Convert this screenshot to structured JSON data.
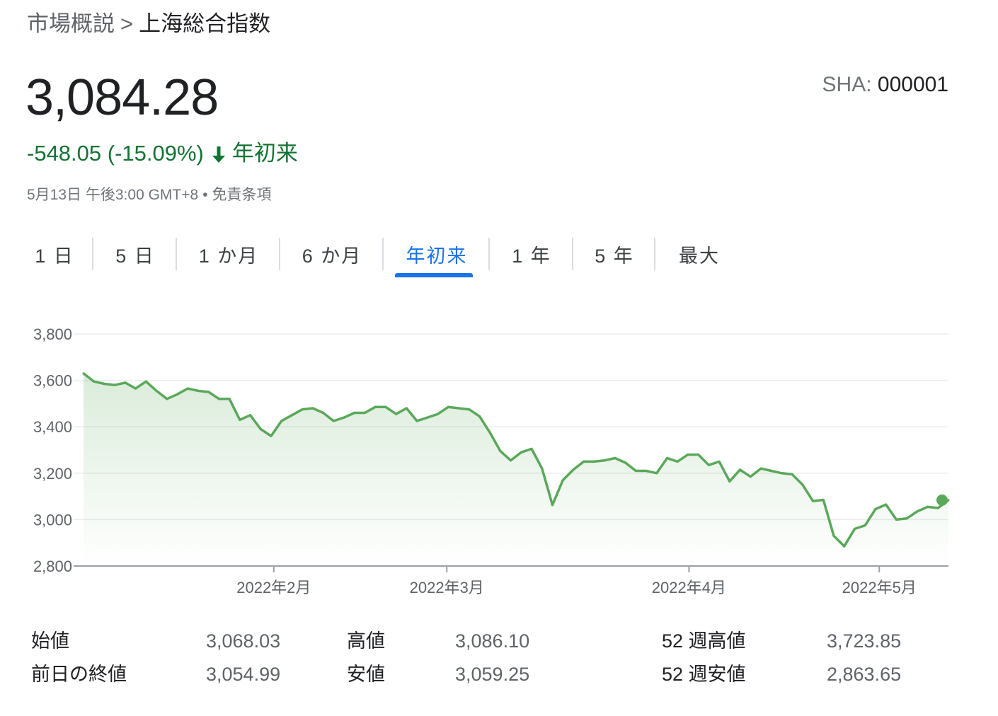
{
  "breadcrumb": {
    "parent": "市場概説",
    "separator": ">",
    "current": "上海総合指数"
  },
  "quote": {
    "price": "3,084.28",
    "ticker_exchange": "SHA: ",
    "ticker_code": "000001",
    "change": "-548.05 (-15.09%)",
    "change_icon": "arrow-down-icon",
    "period": "年初来",
    "timestamp": "5月13日 午後3:00 GMT+8",
    "separator": "•",
    "disclaimer": "免責条項"
  },
  "colors": {
    "positive_negative_text": "#137333",
    "line": "#5aa85a",
    "active_tab": "#1a73e8"
  },
  "tabs": [
    {
      "label": "1 日",
      "active": false
    },
    {
      "label": "5 日",
      "active": false
    },
    {
      "label": "1 か月",
      "active": false
    },
    {
      "label": "6 か月",
      "active": false
    },
    {
      "label": "年初来",
      "active": true
    },
    {
      "label": "1 年",
      "active": false
    },
    {
      "label": "5 年",
      "active": false
    },
    {
      "label": "最大",
      "active": false
    }
  ],
  "chart_data": {
    "type": "area",
    "ylim": [
      2800,
      3800
    ],
    "yticks": [
      "3,800",
      "3,600",
      "3,400",
      "3,200",
      "3,000",
      "2,800"
    ],
    "ytick_values": [
      3800,
      3600,
      3400,
      3200,
      3000,
      2800
    ],
    "xticks": [
      {
        "label": "2022年2月",
        "x": 22
      },
      {
        "label": "2022年3月",
        "x": 42
      },
      {
        "label": "2022年4月",
        "x": 70
      },
      {
        "label": "2022年5月",
        "x": 92
      }
    ],
    "grid": true,
    "series": [
      {
        "values": [
          3630,
          3595,
          3585,
          3580,
          3590,
          3565,
          3595,
          3555,
          3520,
          3540,
          3565,
          3555,
          3550,
          3520,
          3520,
          3430,
          3450,
          3390,
          3360,
          3425,
          3450,
          3475,
          3480,
          3460,
          3425,
          3440,
          3460,
          3460,
          3485,
          3485,
          3455,
          3480,
          3425,
          3440,
          3455,
          3485,
          3480,
          3475,
          3445,
          3375,
          3295,
          3255,
          3290,
          3305,
          3220,
          3063,
          3170,
          3215,
          3250,
          3250,
          3255,
          3265,
          3245,
          3210,
          3210,
          3200,
          3265,
          3250,
          3280,
          3280,
          3235,
          3250,
          3165,
          3215,
          3185,
          3220,
          3210,
          3200,
          3195,
          3150,
          3080,
          3085,
          2930,
          2885,
          2960,
          2975,
          3045,
          3065,
          3000,
          3005,
          3035,
          3055,
          3050,
          3084
        ]
      }
    ]
  },
  "stats": {
    "open_label": "始値",
    "open_value": "3,068.03",
    "prev_close_label": "前日の終値",
    "prev_close_value": "3,054.99",
    "high_label": "高値",
    "high_value": "3,086.10",
    "low_label": "安値",
    "low_value": "3,059.25",
    "wk52_high_label": "52 週高値",
    "wk52_high_value": "3,723.85",
    "wk52_low_label": "52 週安値",
    "wk52_low_value": "2,863.65"
  }
}
